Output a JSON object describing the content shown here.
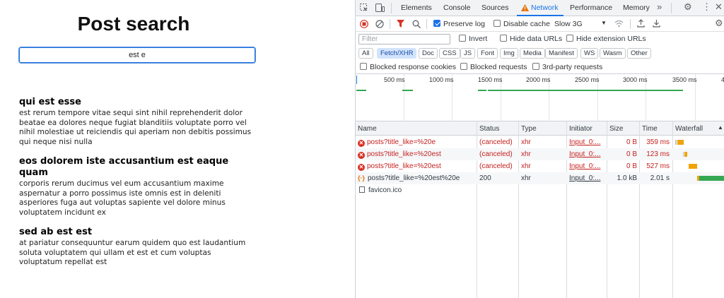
{
  "page": {
    "title": "Post search",
    "search_value": "est e",
    "posts": [
      {
        "title": "qui est esse",
        "body": "est rerum tempore vitae sequi sint nihil reprehenderit dolor beatae ea dolores neque fugiat blanditiis voluptate porro vel nihil molestiae ut reiciendis qui aperiam non debitis possimus qui neque nisi nulla"
      },
      {
        "title": "eos dolorem iste accusantium est eaque quam",
        "body": "corporis rerum ducimus vel eum accusantium maxime aspernatur a porro possimus iste omnis est in deleniti asperiores fuga aut voluptas sapiente vel dolore minus voluptatem incidunt ex"
      },
      {
        "title": "sed ab est est",
        "body": "at pariatur consequuntur earum quidem quo est laudantium soluta voluptatem qui ullam et est et cum voluptas voluptatum repellat est"
      }
    ]
  },
  "devtools": {
    "tabs": [
      "Elements",
      "Console",
      "Sources",
      "Network",
      "Performance",
      "Memory"
    ],
    "active_tab": "Network",
    "toolbar": {
      "preserve_log": "Preserve log",
      "disable_cache": "Disable cache",
      "throttle": "Slow 3G"
    },
    "filter": {
      "placeholder": "Filter",
      "invert": "Invert",
      "hide_data_urls": "Hide data URLs",
      "hide_extension_urls": "Hide extension URLs"
    },
    "type_filters": [
      "All",
      "Fetch/XHR",
      "Doc",
      "CSS",
      "JS",
      "Font",
      "Img",
      "Media",
      "Manifest",
      "WS",
      "Wasm",
      "Other"
    ],
    "active_type": "Fetch/XHR",
    "block_options": [
      "Blocked response cookies",
      "Blocked requests",
      "3rd-party requests"
    ],
    "timeline_ticks": [
      "500 ms",
      "1000 ms",
      "1500 ms",
      "2000 ms",
      "2500 ms",
      "3000 ms",
      "3500 ms"
    ],
    "columns": [
      "Name",
      "Status",
      "Type",
      "Initiator",
      "Size",
      "Time",
      "Waterfall"
    ],
    "requests": [
      {
        "name": "posts?title_like=%20e",
        "status": "(canceled)",
        "type": "xhr",
        "initiator": "Input_0:...",
        "size": "0 B",
        "time": "359 ms",
        "error": true
      },
      {
        "name": "posts?title_like=%20est",
        "status": "(canceled)",
        "type": "xhr",
        "initiator": "Input_0:...",
        "size": "0 B",
        "time": "123 ms",
        "error": true
      },
      {
        "name": "posts?title_like=%20est",
        "status": "(canceled)",
        "type": "xhr",
        "initiator": "Input_0:...",
        "size": "0 B",
        "time": "527 ms",
        "error": true
      },
      {
        "name": "posts?title_like=%20est%20e",
        "status": "200",
        "type": "xhr",
        "initiator": "Input_0:...",
        "size": "1.0 kB",
        "time": "2.01 s",
        "error": false
      },
      {
        "name": "favicon.ico",
        "status": "",
        "type": "",
        "initiator": "",
        "size": "",
        "time": "",
        "error": false
      }
    ],
    "colors": {
      "accent": "#1a73e8",
      "error": "#c5221f",
      "waterfall_wait": "#f0a30a",
      "waterfall_download": "#34a853"
    }
  }
}
